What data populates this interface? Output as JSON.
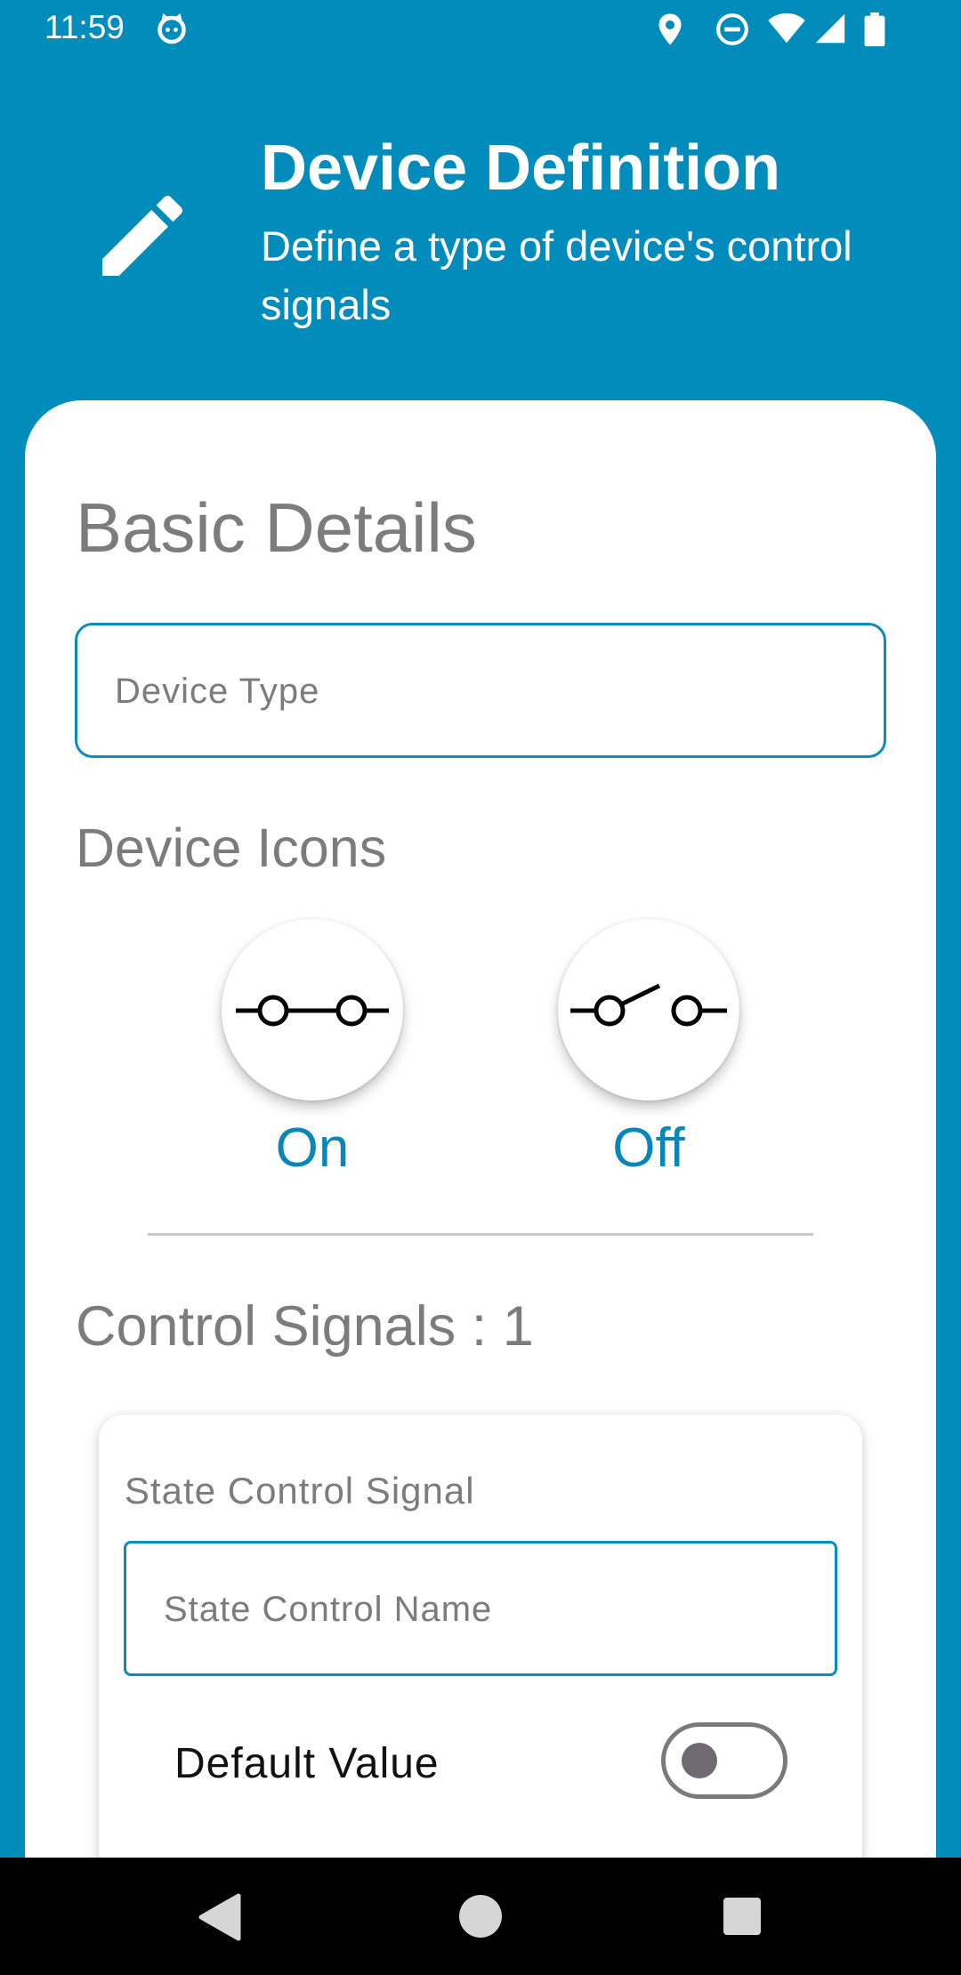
{
  "status_bar": {
    "time": "11:59",
    "icons": [
      "cat-notification-icon",
      "location-icon",
      "do-not-disturb-icon",
      "wifi-icon",
      "cellular-signal-icon",
      "battery-icon"
    ]
  },
  "header": {
    "icon": "pencil-icon",
    "title": "Device Definition",
    "subtitle": "Define a type of device's control signals"
  },
  "basic_details": {
    "title": "Basic Details",
    "device_type_placeholder": "Device Type"
  },
  "device_icons": {
    "title": "Device Icons",
    "on_label": "On",
    "off_label": "Off",
    "on_icon": "switch-closed-icon",
    "off_icon": "switch-open-icon"
  },
  "control_signals": {
    "title": "Control Signals : 1",
    "signal": {
      "type_label": "State Control Signal",
      "name_placeholder": "State Control Name",
      "default_label": "Default Value",
      "default_value": false
    }
  },
  "colors": {
    "primary": "#018cbb",
    "accent_text": "#0a87b8",
    "muted_text": "#7c7c7c"
  },
  "nav_bar": {
    "icons": [
      "back-icon",
      "home-icon",
      "recents-icon"
    ]
  }
}
